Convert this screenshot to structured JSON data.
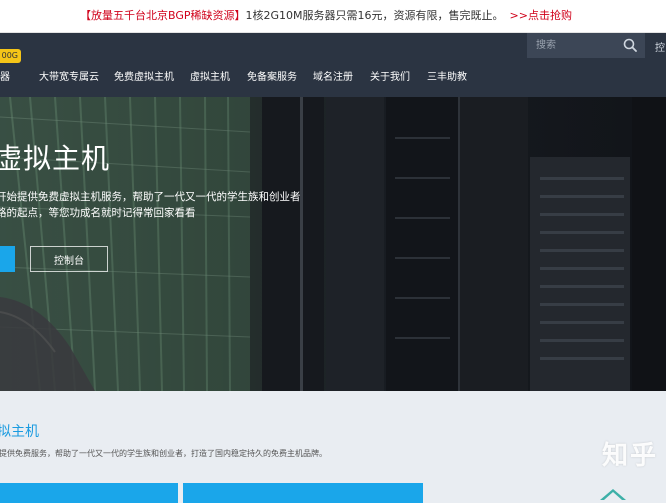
{
  "promo": {
    "highlight": "【放量五千台北京BGP稀缺资源】",
    "text": "1核2G10M服务器只需16元，资源有限，售完既止。",
    "cta": ">>点击抢购"
  },
  "header": {
    "badge": "00G",
    "search_placeholder": "搜索",
    "login_label": "控",
    "nav": [
      {
        "label": "务器"
      },
      {
        "label": "大带宽专属云"
      },
      {
        "label": "免费虚拟主机"
      },
      {
        "label": "虚拟主机"
      },
      {
        "label": "免备案服务"
      },
      {
        "label": "域名注册"
      },
      {
        "label": "关于我们"
      },
      {
        "label": "三丰助教"
      }
    ]
  },
  "hero": {
    "title": "虚拟主机",
    "desc_line1": "开始提供免费虚拟主机服务，帮助了一代又一代的学生族和创业者",
    "desc_line2": "路的起点，等您功成名就时记得常回家看看",
    "primary_label": "",
    "console_label": "控制台"
  },
  "section": {
    "title": "拟主机",
    "desc": "提供免费服务，帮助了一代又一代的学生族和创业者，打造了国内稳定持久的免费主机品牌。"
  },
  "watermark": {
    "text": "知乎"
  },
  "colors": {
    "accent": "#1aa6ea",
    "header": "#2b3442",
    "promo_red": "#d0021b",
    "badge": "#f5c518"
  }
}
